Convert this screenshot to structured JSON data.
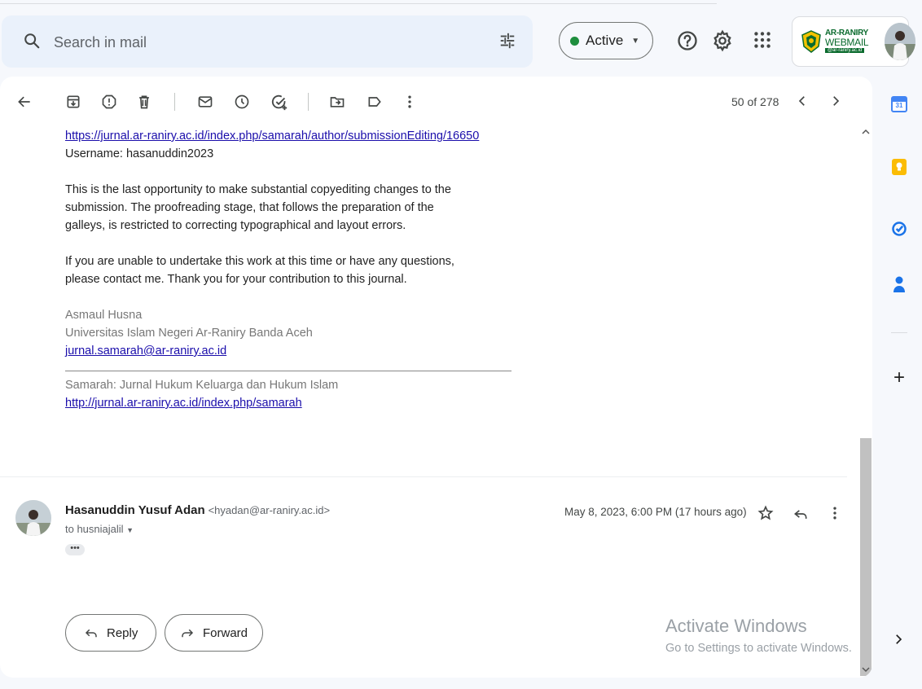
{
  "search": {
    "placeholder": "Search in mail"
  },
  "status": {
    "label": "Active",
    "color": "#1e8e3e"
  },
  "brand": {
    "line1": "AR-RANIRY",
    "line2": "WEBMAIL",
    "line3": "@ar-raniry.ac.id"
  },
  "pager": {
    "label": "50 of 278"
  },
  "message_body": {
    "link1": "https://jurnal.ar-raniry.ac.id/index.php/samarah/author/submissionEditing/16650",
    "username": "Username: hasanuddin2023",
    "para1_lines": [
      "This is the last opportunity to make substantial copyediting changes to the",
      "submission. The proofreading stage, that follows the preparation of the",
      "galleys, is restricted to correcting typographical and layout errors."
    ],
    "para2_lines": [
      "If you are unable to undertake this work at this time or have any questions,",
      "please contact me. Thank you for your contribution to this journal."
    ],
    "sig_name": "Asmaul Husna",
    "sig_org": "Universitas Islam Negeri Ar-Raniry Banda Aceh",
    "sig_email": "jurnal.samarah@ar-raniry.ac.id",
    "journal_name": "Samarah: Jurnal Hukum Keluarga dan Hukum Islam",
    "journal_link": "http://jurnal.ar-raniry.ac.id/index.php/samarah"
  },
  "reply_message": {
    "sender_name": "Hasanuddin Yusuf Adan",
    "sender_email": "<hyadan@ar-raniry.ac.id>",
    "to": "to husniajalil",
    "date": "May 8, 2023, 6:00 PM (17 hours ago)",
    "ellipsis": "•••"
  },
  "actions": {
    "reply": "Reply",
    "forward": "Forward"
  },
  "watermark": {
    "line1": "Activate Windows",
    "line2": "Go to Settings to activate Windows."
  },
  "side": {
    "calendar_day": "31",
    "add": "+"
  }
}
